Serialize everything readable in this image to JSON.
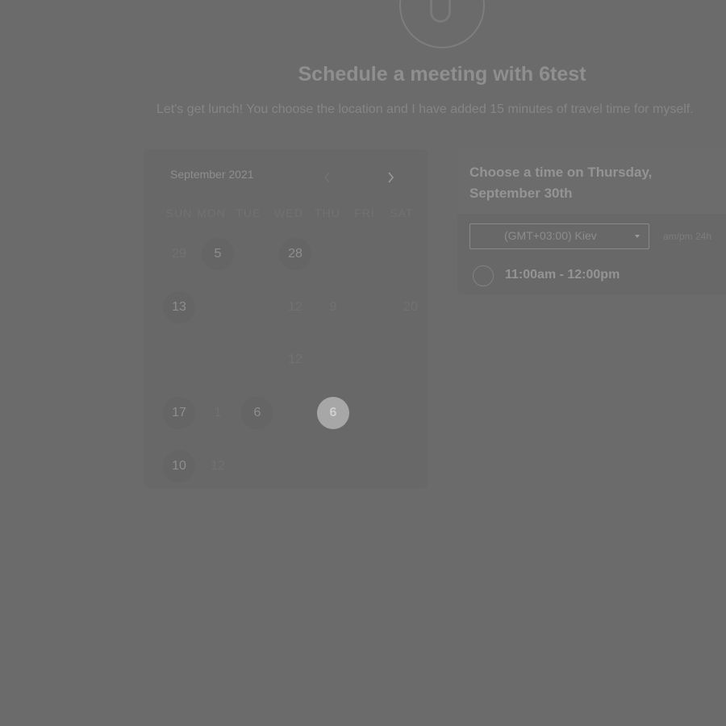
{
  "header": {
    "title": "Schedule a meeting with 6test",
    "description": "Let's get lunch! You choose the location and I have added 15 minutes of travel time for myself."
  },
  "calendar": {
    "month_label": "September 2021",
    "weekdays": [
      "SUN",
      "MON",
      "TUE",
      "WED",
      "THU",
      "FRI",
      "SAT"
    ],
    "days": [
      {
        "label": "29",
        "col": 0,
        "row": 0,
        "state": "faint"
      },
      {
        "label": "5",
        "col": 1,
        "row": 0,
        "state": "available"
      },
      {
        "label": "28",
        "col": 3,
        "row": 0,
        "state": "available"
      },
      {
        "label": "13",
        "col": 0,
        "row": 1,
        "state": "available"
      },
      {
        "label": "12",
        "col": 3,
        "row": 1,
        "state": "faint"
      },
      {
        "label": "9",
        "col": 4,
        "row": 1,
        "state": "faint"
      },
      {
        "label": "20",
        "col": 6,
        "row": 1,
        "state": "faint"
      },
      {
        "label": "12",
        "col": 3,
        "row": 2,
        "state": "faint"
      },
      {
        "label": "17",
        "col": 0,
        "row": 3,
        "state": "available"
      },
      {
        "label": "1",
        "col": 1,
        "row": 3,
        "state": "faint"
      },
      {
        "label": "6",
        "col": 2,
        "row": 3,
        "state": "available"
      },
      {
        "label": "6",
        "col": 4,
        "row": 3,
        "state": "selected"
      },
      {
        "label": "10",
        "col": 0,
        "row": 4,
        "state": "available"
      },
      {
        "label": "12",
        "col": 1,
        "row": 4,
        "state": "faint"
      }
    ]
  },
  "times": {
    "heading": "Choose a time on Thursday, September 30th",
    "timezone": "(GMT+03:00) Kiev",
    "format_toggle": "am/pm 24h",
    "slots": [
      "11:00am - 12:00pm"
    ]
  },
  "icons": {
    "prev": "chevron-left-icon",
    "next": "chevron-right-icon",
    "dropdown": "caret-down-icon"
  }
}
